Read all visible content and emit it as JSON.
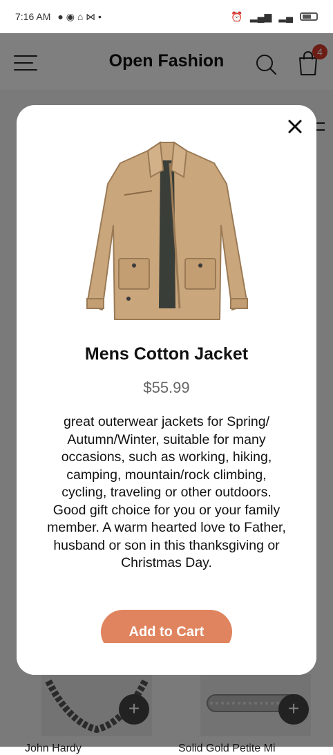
{
  "status_bar": {
    "time": "7:16 AM"
  },
  "header": {
    "title": "Open Fashion",
    "cart_count": "4"
  },
  "background": {
    "product_left_name": "John Hardy",
    "product_right_name": "Solid Gold Petite Mi"
  },
  "modal": {
    "product_name": "Mens Cotton Jacket",
    "price": "$55.99",
    "description": "great outerwear jackets for Spring/ Autumn/Winter, suitable for many occasions, such as working, hiking, camping, mountain/rock climbing, cycling, traveling or other outdoors. Good gift choice for you or your family member. A warm hearted love to Father, husband or son in this thanksgiving or Christmas Day.",
    "add_to_cart_label": "Add to Cart"
  },
  "icons": {
    "menu": "menu-icon",
    "search": "search-icon",
    "cart": "cart-icon",
    "close": "close-icon",
    "filter": "filter-icon",
    "plus": "plus-icon"
  },
  "colors": {
    "accent": "#e0845f",
    "badge": "#d83a2a",
    "overlay": "#000000"
  }
}
